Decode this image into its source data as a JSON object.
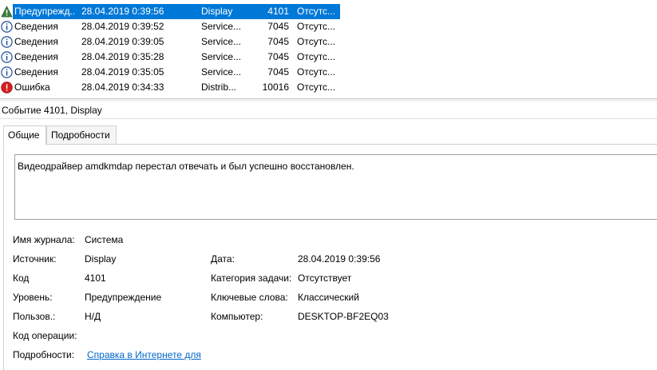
{
  "events": [
    {
      "level": "Предупрежд...",
      "date": "28.04.2019 0:39:56",
      "source": "Display",
      "id": "4101",
      "category": "Отсутс...",
      "icon": "warning-icon",
      "selected": true
    },
    {
      "level": "Сведения",
      "date": "28.04.2019 0:39:52",
      "source": "Service...",
      "id": "7045",
      "category": "Отсутс...",
      "icon": "info-icon"
    },
    {
      "level": "Сведения",
      "date": "28.04.2019 0:39:05",
      "source": "Service...",
      "id": "7045",
      "category": "Отсутс...",
      "icon": "info-icon"
    },
    {
      "level": "Сведения",
      "date": "28.04.2019 0:35:28",
      "source": "Service...",
      "id": "7045",
      "category": "Отсутс...",
      "icon": "info-icon"
    },
    {
      "level": "Сведения",
      "date": "28.04.2019 0:35:05",
      "source": "Service...",
      "id": "7045",
      "category": "Отсутс...",
      "icon": "info-icon"
    },
    {
      "level": "Ошибка",
      "date": "28.04.2019 0:34:33",
      "source": "Distrib...",
      "id": "10016",
      "category": "Отсутс...",
      "icon": "error-icon"
    }
  ],
  "colors": {
    "selection": "#0078d7",
    "warning": "#3c7d3c",
    "info": "#1f4e9a",
    "error": "#d61f1f",
    "link": "#0066cc"
  },
  "detail": {
    "title": "Событие 4101, Display",
    "tabs": {
      "general": "Общие",
      "details": "Подробности"
    },
    "message": "Видеодрайвер amdkmdap перестал отвечать и был успешно восстановлен.",
    "labels": {
      "log_name": "Имя журнала:",
      "source": "Источник:",
      "event_id": "Код",
      "level": "Уровень:",
      "user": "Пользов.:",
      "opcode": "Код операции:",
      "more_info": "Подробности:",
      "logged": "Дата:",
      "task_category": "Категория задачи:",
      "keywords": "Ключевые слова:",
      "computer": "Компьютер:"
    },
    "values": {
      "log_name": "Система",
      "source": "Display",
      "event_id": "4101",
      "level": "Предупреждение",
      "user": "Н/Д",
      "opcode": "",
      "more_info_link": "Справка в Интернете для",
      "logged": "28.04.2019 0:39:56",
      "task_category": "Отсутствует",
      "keywords": "Классический",
      "computer": "DESKTOP-BF2EQ03"
    }
  }
}
